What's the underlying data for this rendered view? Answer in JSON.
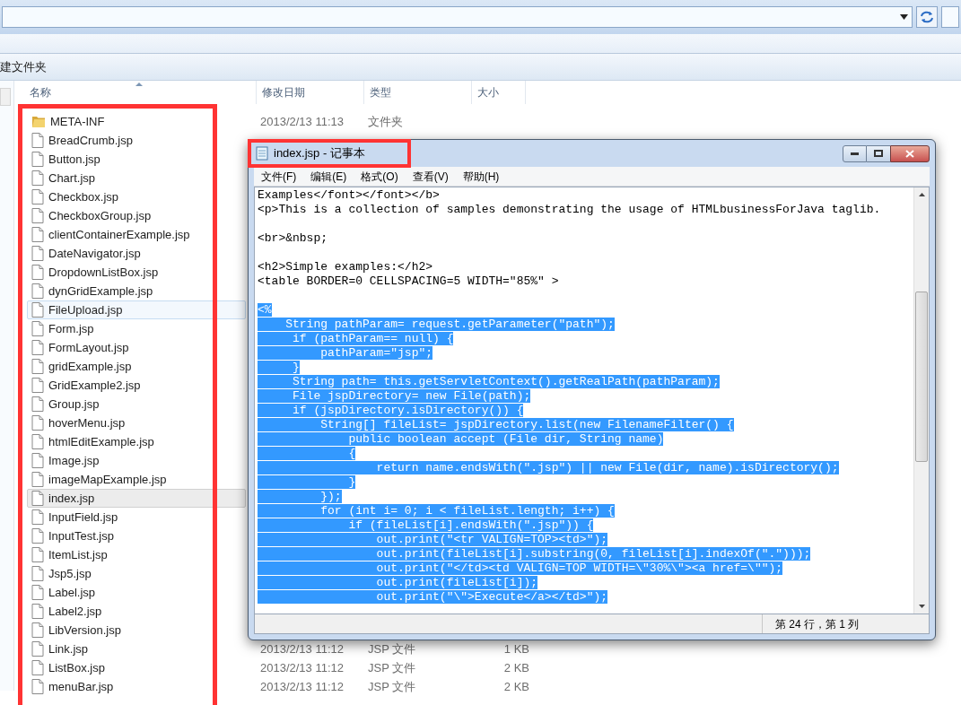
{
  "explorer": {
    "toolbar": {
      "new_folder": "建文件夹"
    },
    "columns": [
      "名称",
      "修改日期",
      "类型",
      "大小"
    ],
    "files": [
      {
        "name": "META-INF",
        "kind": "folder",
        "modified": "2013/2/13 11:13",
        "type": "文件夹",
        "selected": false,
        "hovered": false
      },
      {
        "name": "BreadCrumb.jsp",
        "kind": "file",
        "selected": false,
        "hovered": false
      },
      {
        "name": "Button.jsp",
        "kind": "file",
        "selected": false,
        "hovered": false
      },
      {
        "name": "Chart.jsp",
        "kind": "file",
        "selected": false,
        "hovered": false
      },
      {
        "name": "Checkbox.jsp",
        "kind": "file",
        "selected": false,
        "hovered": false
      },
      {
        "name": "CheckboxGroup.jsp",
        "kind": "file",
        "selected": false,
        "hovered": false
      },
      {
        "name": "clientContainerExample.jsp",
        "kind": "file",
        "selected": false,
        "hovered": false
      },
      {
        "name": "DateNavigator.jsp",
        "kind": "file",
        "selected": false,
        "hovered": false
      },
      {
        "name": "DropdownListBox.jsp",
        "kind": "file",
        "selected": false,
        "hovered": false
      },
      {
        "name": "dynGridExample.jsp",
        "kind": "file",
        "selected": false,
        "hovered": false
      },
      {
        "name": "FileUpload.jsp",
        "kind": "file",
        "selected": false,
        "hovered": true
      },
      {
        "name": "Form.jsp",
        "kind": "file",
        "selected": false,
        "hovered": false
      },
      {
        "name": "FormLayout.jsp",
        "kind": "file",
        "selected": false,
        "hovered": false
      },
      {
        "name": "gridExample.jsp",
        "kind": "file",
        "selected": false,
        "hovered": false
      },
      {
        "name": "GridExample2.jsp",
        "kind": "file",
        "selected": false,
        "hovered": false
      },
      {
        "name": "Group.jsp",
        "kind": "file",
        "selected": false,
        "hovered": false
      },
      {
        "name": "hoverMenu.jsp",
        "kind": "file",
        "selected": false,
        "hovered": false
      },
      {
        "name": "htmlEditExample.jsp",
        "kind": "file",
        "selected": false,
        "hovered": false
      },
      {
        "name": "Image.jsp",
        "kind": "file",
        "selected": false,
        "hovered": false
      },
      {
        "name": "imageMapExample.jsp",
        "kind": "file",
        "selected": false,
        "hovered": false
      },
      {
        "name": "index.jsp",
        "kind": "file",
        "selected": true,
        "hovered": false
      },
      {
        "name": "InputField.jsp",
        "kind": "file",
        "selected": false,
        "hovered": false
      },
      {
        "name": "InputTest.jsp",
        "kind": "file",
        "selected": false,
        "hovered": false
      },
      {
        "name": "ItemList.jsp",
        "kind": "file",
        "selected": false,
        "hovered": false
      },
      {
        "name": "Jsp5.jsp",
        "kind": "file",
        "selected": false,
        "hovered": false
      },
      {
        "name": "Label.jsp",
        "kind": "file",
        "selected": false,
        "hovered": false
      },
      {
        "name": "Label2.jsp",
        "kind": "file",
        "selected": false,
        "hovered": false
      },
      {
        "name": "LibVersion.jsp",
        "kind": "file",
        "selected": false,
        "hovered": false
      },
      {
        "name": "Link.jsp",
        "kind": "file",
        "modified": "2013/2/13 11:12",
        "type": "JSP 文件",
        "size": "1 KB",
        "selected": false,
        "hovered": false
      },
      {
        "name": "ListBox.jsp",
        "kind": "file",
        "modified": "2013/2/13 11:12",
        "type": "JSP 文件",
        "size": "2 KB",
        "selected": false,
        "hovered": false
      },
      {
        "name": "menuBar.jsp",
        "kind": "file",
        "modified": "2013/2/13 11:12",
        "type": "JSP 文件",
        "size": "2 KB",
        "selected": false,
        "hovered": false
      }
    ]
  },
  "notepad": {
    "title": "index.jsp - 记事本",
    "menu": [
      "文件(F)",
      "编辑(E)",
      "格式(O)",
      "查看(V)",
      "帮助(H)"
    ],
    "lines": [
      {
        "kind": "text",
        "text": "Examples</font></font></b>",
        "selected": false
      },
      {
        "kind": "text",
        "text": "<p>This is a collection of samples demonstrating the usage of HTMLbusinessForJava taglib.",
        "selected": false
      },
      {
        "kind": "blank",
        "selected": false
      },
      {
        "kind": "text",
        "text": "<br>&nbsp;",
        "selected": false
      },
      {
        "kind": "blank",
        "selected": false
      },
      {
        "kind": "text",
        "text": "<h2>Simple examples:</h2>",
        "selected": false
      },
      {
        "kind": "text",
        "text": "<table BORDER=0 CELLSPACING=5 WIDTH=\"85%\" >",
        "selected": false
      },
      {
        "kind": "blank",
        "selected": false
      },
      {
        "kind": "text",
        "text": "<%",
        "selected": true
      },
      {
        "kind": "text",
        "text": "    String pathParam= request.getParameter(\"path\");",
        "selected": true
      },
      {
        "kind": "text",
        "text": "     if (pathParam== null) {",
        "selected": true
      },
      {
        "kind": "text",
        "text": "         pathParam=\"jsp\";",
        "selected": true
      },
      {
        "kind": "text",
        "text": "     }",
        "selected": true
      },
      {
        "kind": "text",
        "text": "     String path= this.getServletContext().getRealPath(pathParam);",
        "selected": true
      },
      {
        "kind": "text",
        "text": "     File jspDirectory= new File(path);",
        "selected": true
      },
      {
        "kind": "text",
        "text": "     if (jspDirectory.isDirectory()) {",
        "selected": true
      },
      {
        "kind": "text",
        "text": "         String[] fileList= jspDirectory.list(new FilenameFilter() {",
        "selected": true
      },
      {
        "kind": "text",
        "text": "             public boolean accept (File dir, String name)",
        "selected": true
      },
      {
        "kind": "text",
        "text": "             {",
        "selected": true
      },
      {
        "kind": "text",
        "text": "                 return name.endsWith(\".jsp\") || new File(dir, name).isDirectory();",
        "selected": true
      },
      {
        "kind": "text",
        "text": "             }",
        "selected": true
      },
      {
        "kind": "text",
        "text": "         });",
        "selected": true
      },
      {
        "kind": "text",
        "text": "         for (int i= 0; i < fileList.length; i++) {",
        "selected": true
      },
      {
        "kind": "text",
        "text": "             if (fileList[i].endsWith(\".jsp\")) {",
        "selected": true
      },
      {
        "kind": "text",
        "text": "                 out.print(\"<tr VALIGN=TOP><td>\");",
        "selected": true
      },
      {
        "kind": "text",
        "text": "                 out.print(fileList[i].substring(0, fileList[i].indexOf(\".\")));",
        "selected": true
      },
      {
        "kind": "text",
        "text": "                 out.print(\"</td><td VALIGN=TOP WIDTH=\\\"30%\\\"><a href=\\\"\");",
        "selected": true
      },
      {
        "kind": "text",
        "text": "                 out.print(fileList[i]);",
        "selected": true
      },
      {
        "kind": "text",
        "text": "                 out.print(\"\\\">Execute</a></td>\");",
        "selected": true
      }
    ],
    "status": "第 24 行，第 1 列"
  }
}
